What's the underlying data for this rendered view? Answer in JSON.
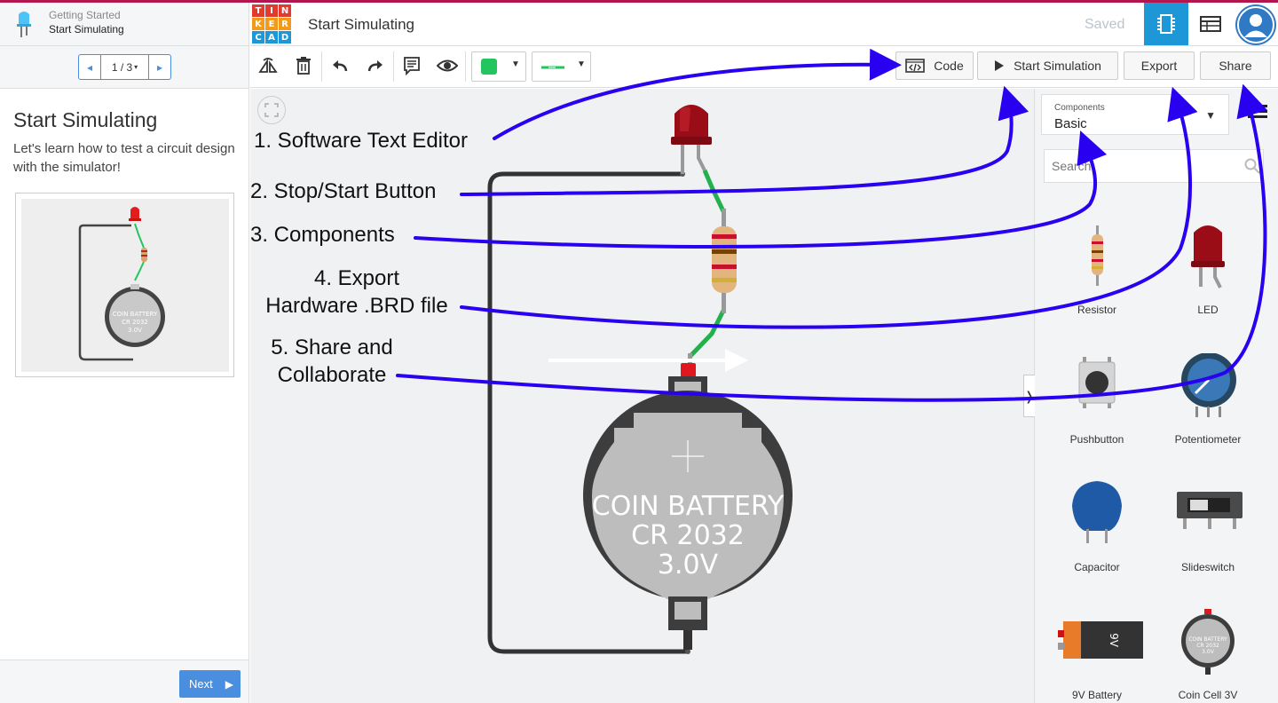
{
  "lesson": {
    "category": "Getting Started",
    "name": "Start Simulating",
    "pager": "1 / 3",
    "title": "Start Simulating",
    "description": "Let's learn how to test a circuit design with the simulator!",
    "thumb_battery": [
      "COIN BATTERY",
      "CR 2032",
      "3.0V"
    ],
    "next_label": "Next"
  },
  "header": {
    "logo_letters": [
      "T",
      "I",
      "N",
      "K",
      "E",
      "R",
      "C",
      "A",
      "D"
    ],
    "logo_colors": [
      "#e33a2f",
      "#e33a2f",
      "#e33a2f",
      "#f29a1b",
      "#f29a1b",
      "#f29a1b",
      "#1e97d7",
      "#1e97d7",
      "#1e97d7"
    ],
    "project_title": "Start Simulating",
    "status": "Saved"
  },
  "toolbar": {
    "code_label": "Code",
    "simulation_label": "Start Simulation",
    "export_label": "Export",
    "share_label": "Share",
    "wire_color": "#22c55e"
  },
  "circuit": {
    "battery_lines": [
      "COIN BATTERY",
      "CR 2032",
      "3.0V"
    ]
  },
  "annotations": {
    "a1": "1. Software Text Editor",
    "a2": "2. Stop/Start Button",
    "a3": "3. Components",
    "a4_line1": "4. Export",
    "a4_line2": "Hardware .BRD file",
    "a5_line1": "5. Share and",
    "a5_line2": "Collaborate",
    "arrow_color": "#2a00f0"
  },
  "components": {
    "label": "Components",
    "selected": "Basic",
    "search_placeholder": "Search",
    "items": [
      {
        "name": "Resistor",
        "icon": "resistor-icon"
      },
      {
        "name": "LED",
        "icon": "led-icon"
      },
      {
        "name": "Pushbutton",
        "icon": "pushbutton-icon"
      },
      {
        "name": "Potentiometer",
        "icon": "potentiometer-icon"
      },
      {
        "name": "Capacitor",
        "icon": "capacitor-icon"
      },
      {
        "name": "Slideswitch",
        "icon": "slideswitch-icon"
      },
      {
        "name": "9V Battery",
        "icon": "battery-9v-icon"
      },
      {
        "name": "Coin Cell 3V",
        "icon": "coin-cell-icon"
      }
    ],
    "battery9v_label": "9V",
    "coin_lines": [
      "COIN BATTERY",
      "CR 2032",
      "3.0V"
    ]
  }
}
